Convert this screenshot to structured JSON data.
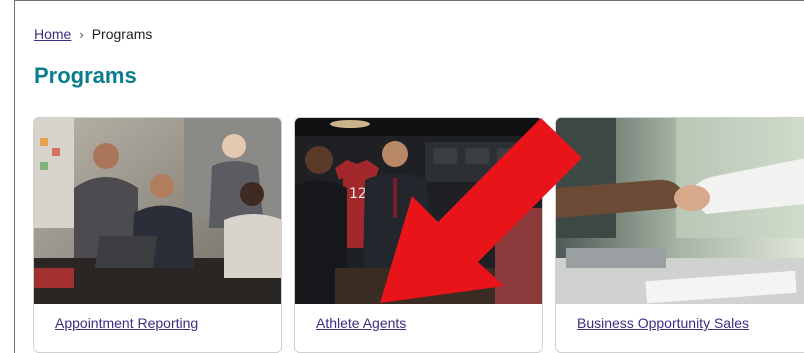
{
  "breadcrumb": {
    "home": "Home",
    "separator": "›",
    "current": "Programs"
  },
  "page": {
    "title": "Programs"
  },
  "cards": [
    {
      "label": "Appointment Reporting",
      "image": "office-meeting-photo"
    },
    {
      "label": "Athlete Agents",
      "image": "sports-agents-photo",
      "jersey_number": "12"
    },
    {
      "label": "Business Opportunity Sales",
      "image": "handshake-photo"
    }
  ],
  "annotation": {
    "arrow_icon": "red-arrow-icon",
    "arrow_color": "#e8141a"
  },
  "colors": {
    "title": "#0a7d8c",
    "link": "#3d2d82"
  }
}
